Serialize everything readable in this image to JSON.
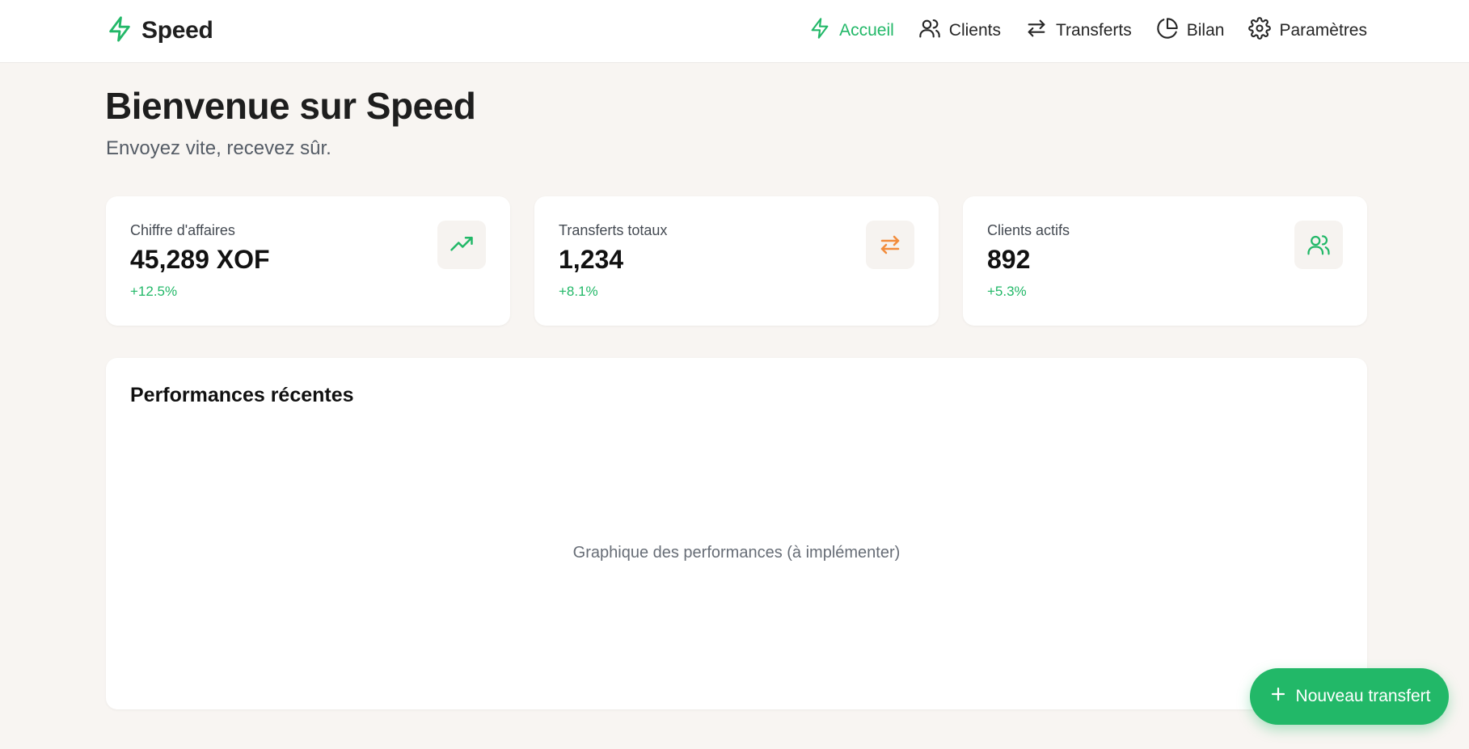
{
  "brand": {
    "name": "Speed",
    "icon": "lightning-icon"
  },
  "nav": {
    "items": [
      {
        "label": "Accueil",
        "icon": "lightning-icon",
        "active": true
      },
      {
        "label": "Clients",
        "icon": "users-icon",
        "active": false
      },
      {
        "label": "Transferts",
        "icon": "arrows-swap-icon",
        "active": false
      },
      {
        "label": "Bilan",
        "icon": "pie-chart-icon",
        "active": false
      },
      {
        "label": "Paramètres",
        "icon": "gear-icon",
        "active": false
      }
    ]
  },
  "hero": {
    "title": "Bienvenue sur Speed",
    "subtitle": "Envoyez vite, recevez sûr."
  },
  "stats": [
    {
      "label": "Chiffre d'affaires",
      "value": "45,289 XOF",
      "change": "+12.5%",
      "icon": "trending-up-icon",
      "icon_color": "#22b868"
    },
    {
      "label": "Transferts totaux",
      "value": "1,234",
      "change": "+8.1%",
      "icon": "arrows-swap-icon",
      "icon_color": "#f28c3c"
    },
    {
      "label": "Clients actifs",
      "value": "892",
      "change": "+5.3%",
      "icon": "users-icon",
      "icon_color": "#22b868"
    }
  ],
  "performance": {
    "title": "Performances récentes",
    "placeholder": "Graphique des performances (à implémenter)"
  },
  "fab": {
    "label": "Nouveau transfert",
    "icon": "plus-icon"
  },
  "colors": {
    "accent": "#22b868",
    "orange": "#f28c3c",
    "background": "#f8f5f2"
  }
}
